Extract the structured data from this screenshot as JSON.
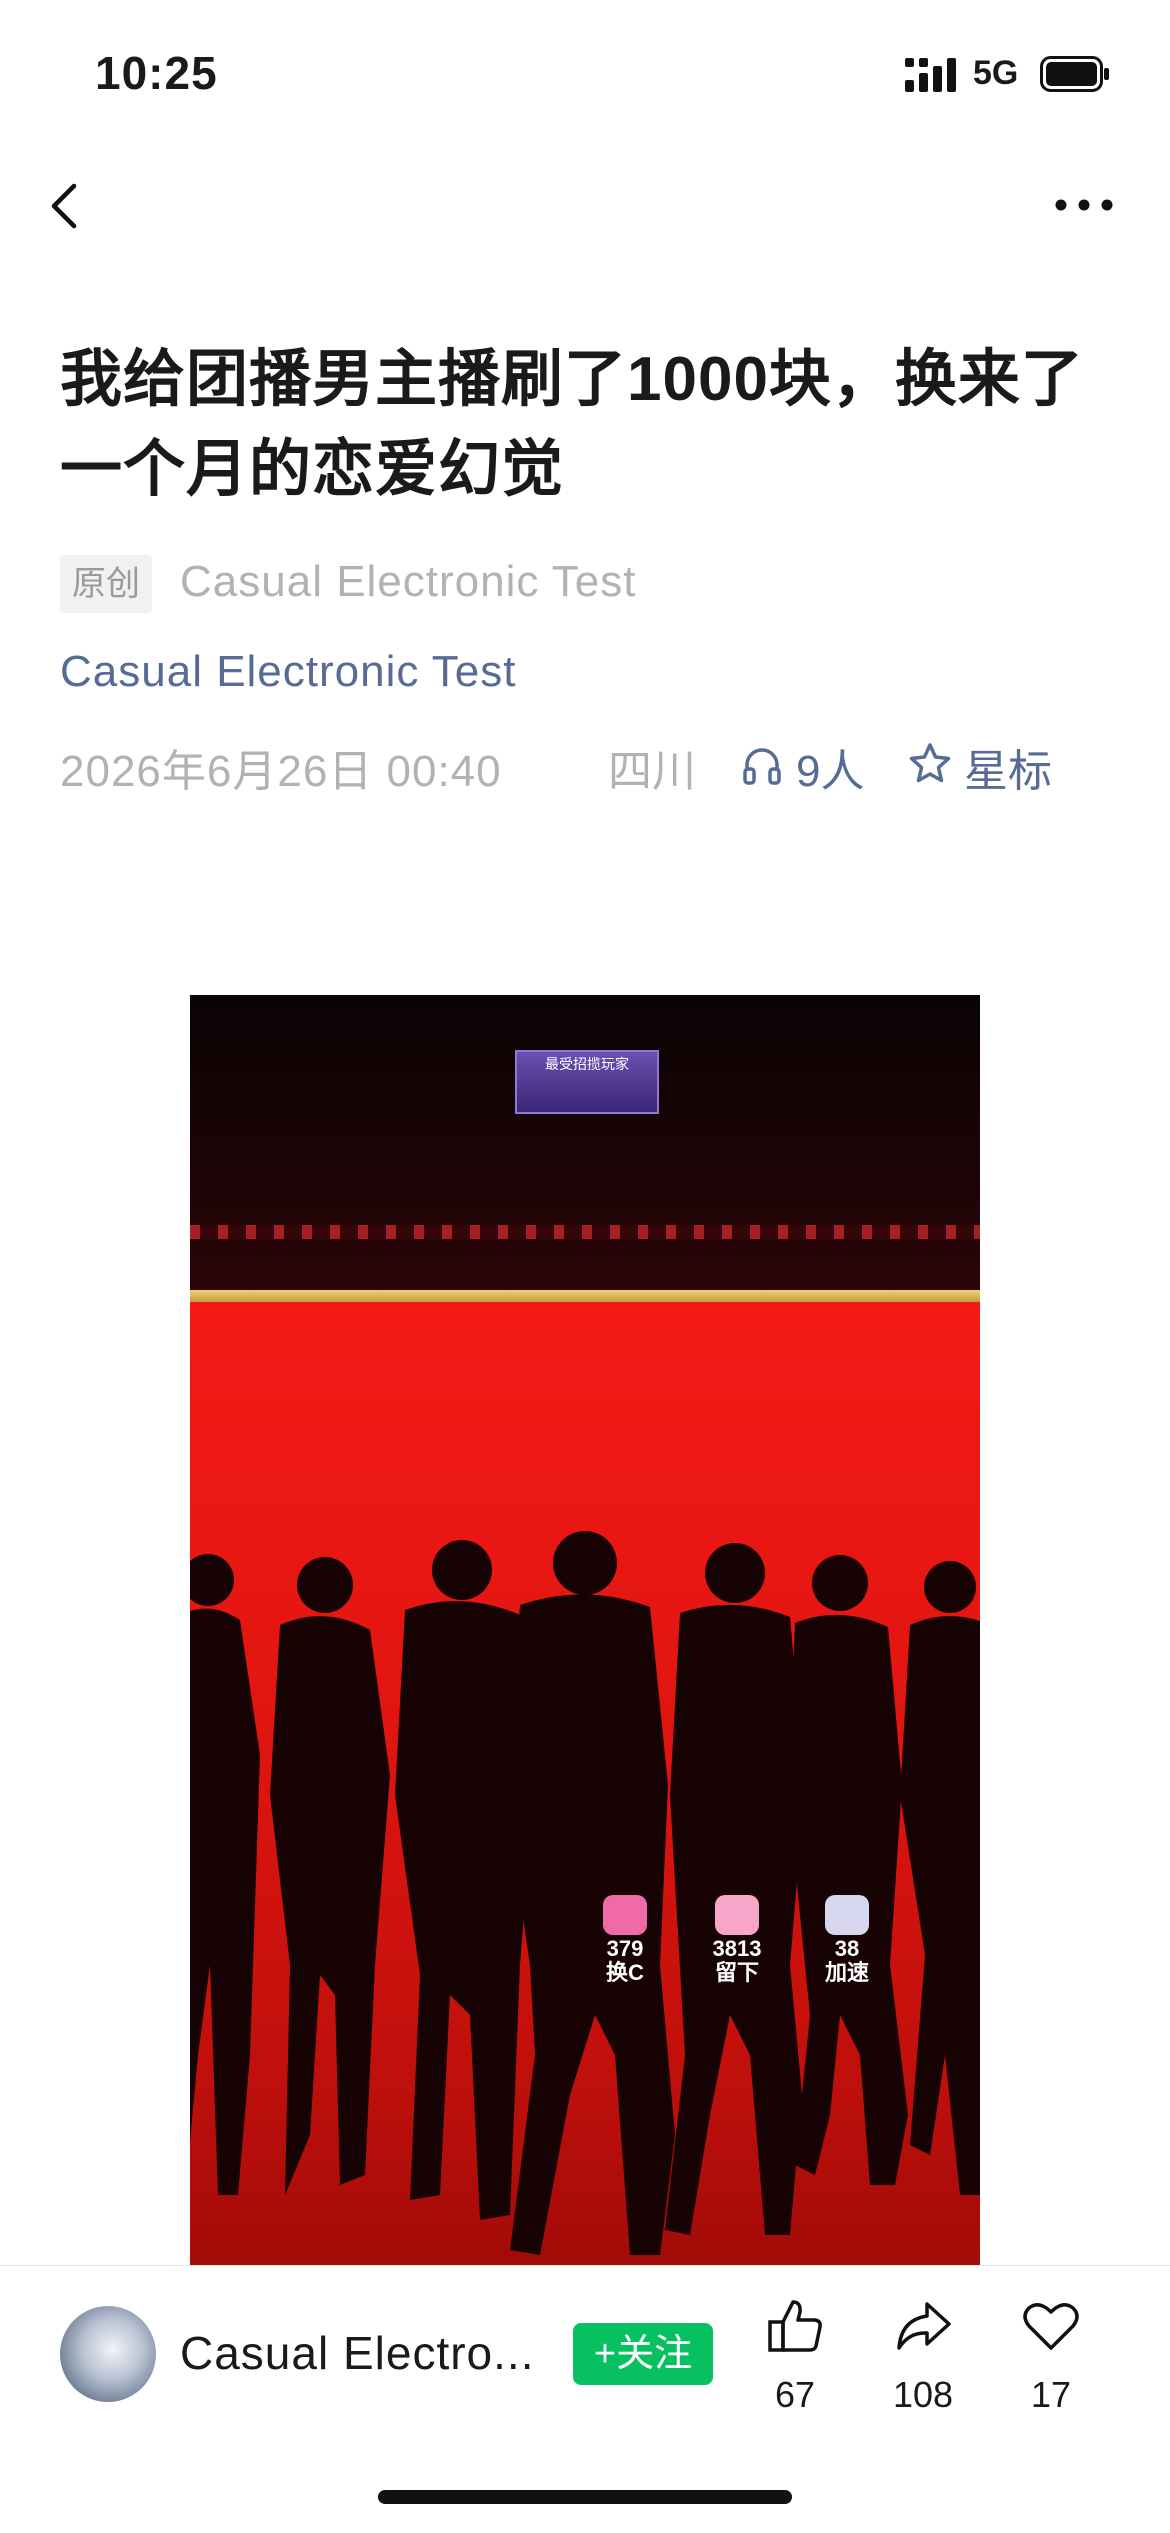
{
  "status_bar": {
    "time": "10:25",
    "network": "5G"
  },
  "nav": {
    "back_icon": "chevron-left-icon",
    "more_icon": "more-dots-icon"
  },
  "article": {
    "title": "我给团播男主播刷了1000块，换来了一个月的恋爱幻觉",
    "original_tag": "原创",
    "author": "Casual Electronic Test",
    "account": "Casual Electronic Test",
    "date": "2026年6月26日 00:40",
    "location": "四川",
    "listen_count": "9人",
    "star_label": "星标"
  },
  "image": {
    "sign_text": "最受招揽玩家",
    "stats": [
      {
        "value": "379",
        "label": "换C",
        "color": "#f06aa8"
      },
      {
        "value": "3813",
        "label": "留下",
        "color": "#f7a5c8"
      },
      {
        "value": "38",
        "label": "加速",
        "color": "#d7d7f0"
      }
    ]
  },
  "bottom": {
    "account_name": "Casual Electro...",
    "follow_label": "+关注",
    "like_count": "67",
    "share_count": "108",
    "favorite_count": "17"
  },
  "colors": {
    "link": "#576b95",
    "follow": "#07c160",
    "muted": "#b2b2b2"
  }
}
